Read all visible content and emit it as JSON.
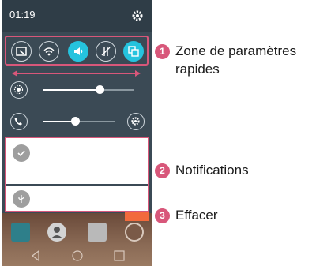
{
  "status_bar": {
    "time": "01:19"
  },
  "quick_settings": {
    "buttons": [
      {
        "icon": "screen-icon",
        "active": false
      },
      {
        "icon": "wifi-icon",
        "active": false
      },
      {
        "icon": "sound-icon",
        "active": true
      },
      {
        "icon": "data-icon",
        "active": false
      },
      {
        "icon": "qslide-icon",
        "active": true
      }
    ],
    "accent_color": "#25c3de"
  },
  "sliders": {
    "brightness": {
      "level": 0.62
    },
    "volume": {
      "level": 0.44
    }
  },
  "callouts": [
    {
      "number": "1",
      "text": "Zone de paramètres rapides"
    },
    {
      "number": "2",
      "text": "Notifications"
    },
    {
      "number": "3",
      "text": "Effacer"
    }
  ],
  "colors": {
    "highlight": "#d8577a",
    "panel_bg": "#3b4a55",
    "clear_button": "#f26a3c"
  }
}
